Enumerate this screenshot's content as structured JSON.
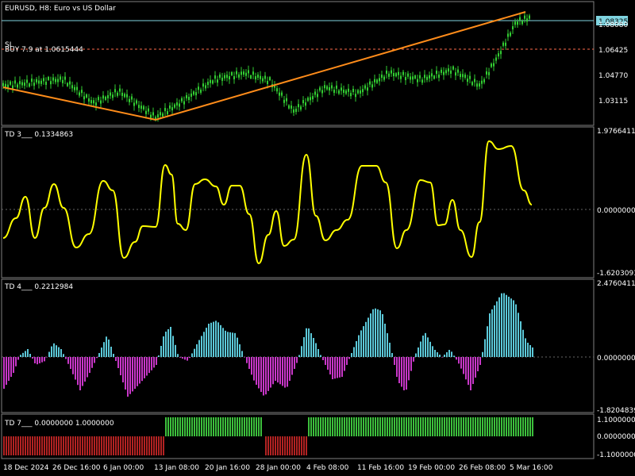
{
  "window": {
    "header_text": "EURUSD, H8:  Euro vs US Dollar",
    "symbol": "EURUSD",
    "timeframe": "H8",
    "description": "Euro vs US Dollar"
  },
  "main_panel": {
    "price_scale": [
      "1.06425",
      "1.04770",
      "1.03115"
    ],
    "current_price_label": "1.08325",
    "hidden_price_label": "1.08080",
    "sl_label": "SL",
    "trade_label": "BUY 7.9 at 1.0615444",
    "colors": {
      "bull_bar": "#32cd32",
      "trendline": "#ff8c1a",
      "bid_line": "#7fd4e0",
      "sl_line": "#ff6b4d",
      "price_tag_bg": "#7fd4e0"
    }
  },
  "panel_td3": {
    "label": "TD 3___  0.1334863",
    "scale_top": "1.9766411",
    "scale_mid": "0.0000000",
    "scale_bottom": "-1.6203093",
    "color": "#ffff00"
  },
  "panel_td4": {
    "label": "TD 4___  0.2212984",
    "scale_top": "2.4760411",
    "scale_mid": "0.0000000",
    "scale_bottom": "-1.8204839",
    "colors": {
      "positive": "#5bc8d8",
      "negative": "#c837c8"
    }
  },
  "panel_td7": {
    "label": "TD 7___  0.0000000  1.0000000",
    "scale_top": "1.1000000",
    "scale_mid": "0.0000000",
    "scale_bottom": "-1.1000000",
    "colors": {
      "positive": "#3cbf3c",
      "negative": "#b22222"
    }
  },
  "time_axis": [
    "18 Dec 2024",
    "26 Dec 16:00",
    "6 Jan 00:00",
    "13 Jan 08:00",
    "20 Jan 16:00",
    "28 Jan 00:00",
    "4 Feb 08:00",
    "11 Feb 16:00",
    "19 Feb 00:00",
    "26 Feb 08:00",
    "5 Mar 16:00"
  ]
}
